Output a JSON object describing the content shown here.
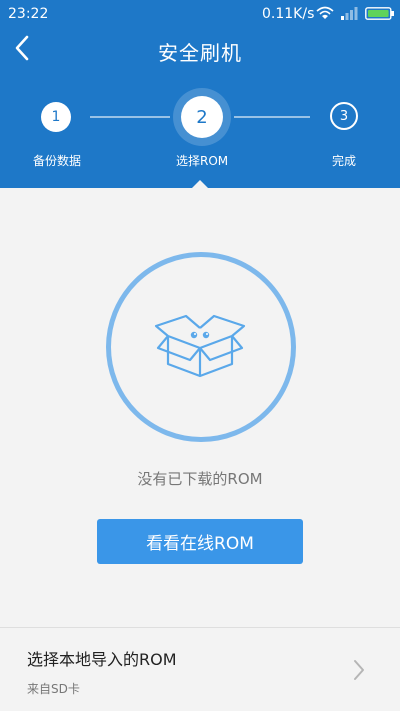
{
  "status_bar": {
    "time": "23:22",
    "speed": "0.11K/s"
  },
  "header": {
    "title": "安全刷机"
  },
  "steps": [
    {
      "number": "1",
      "label": "备份数据"
    },
    {
      "number": "2",
      "label": "选择ROM"
    },
    {
      "number": "3",
      "label": "完成"
    }
  ],
  "empty_state": {
    "message": "没有已下载的ROM",
    "button_label": "看看在线ROM"
  },
  "local_import": {
    "title": "选择本地导入的ROM",
    "subtitle": "来自SD卡"
  },
  "colors": {
    "primary": "#1e78c8",
    "button": "#3a96e8",
    "accent_light": "#7db8ec",
    "background": "#f3f3f3"
  },
  "icons": {
    "back": "back-icon",
    "empty": "box-icon",
    "navigate": "chevron-right-icon"
  }
}
